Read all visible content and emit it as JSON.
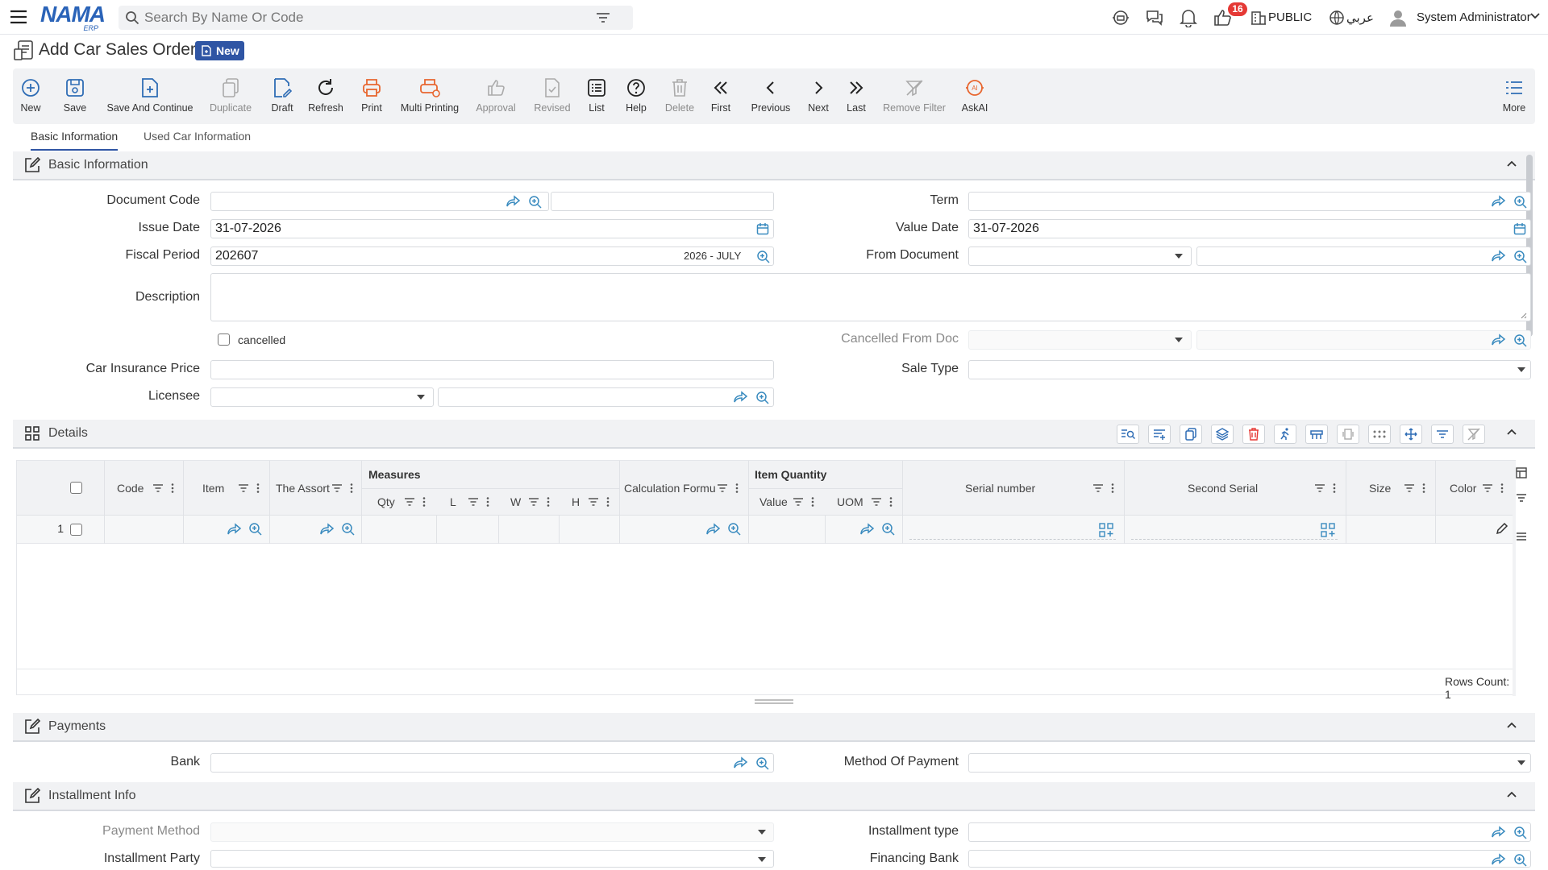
{
  "topbar": {
    "search_placeholder": "Search By Name Or Code",
    "notification_count": "16",
    "branch": "PUBLIC",
    "language": "عربي",
    "user": "System Administrator"
  },
  "page": {
    "title": "Add Car Sales Order",
    "status": "New"
  },
  "toolbar": {
    "new": "New",
    "save": "Save",
    "save_continue": "Save And Continue",
    "duplicate": "Duplicate",
    "draft": "Draft",
    "refresh": "Refresh",
    "print": "Print",
    "multi_printing": "Multi Printing",
    "approval": "Approval",
    "revised": "Revised",
    "list": "List",
    "help": "Help",
    "delete": "Delete",
    "first": "First",
    "previous": "Previous",
    "next": "Next",
    "last": "Last",
    "remove_filter": "Remove Filter",
    "askai": "AskAI",
    "more": "More"
  },
  "tabs": [
    "Basic Information",
    "Used Car Information"
  ],
  "basic": {
    "section": "Basic Information",
    "document_code": "Document Code",
    "term": "Term",
    "issue_date": "Issue Date",
    "issue_date_value": "31-07-2026",
    "value_date": "Value Date",
    "value_date_value": "31-07-2026",
    "fiscal_period": "Fiscal Period",
    "fiscal_period_value": "202607",
    "fiscal_period_name": "2026 - JULY",
    "from_document": "From Document",
    "description": "Description",
    "cancelled": "cancelled",
    "cancelled_from_doc": "Cancelled From Doc",
    "car_insurance_price": "Car Insurance Price",
    "sale_type": "Sale Type",
    "licensee": "Licensee"
  },
  "details": {
    "section": "Details",
    "group_measures": "Measures",
    "group_item_quantity": "Item Quantity",
    "columns": {
      "code": "Code",
      "item": "Item",
      "assort": "The Assort",
      "qty": "Qty",
      "l": "L",
      "w": "W",
      "h": "H",
      "calc": "Calculation Formu",
      "value": "Value",
      "uom": "UOM",
      "serial": "Serial number",
      "second_serial": "Second Serial",
      "size": "Size",
      "color": "Color"
    },
    "row_number": "1",
    "rows_count": "Rows Count: 1"
  },
  "payments": {
    "section": "Payments",
    "bank": "Bank",
    "method_of_payment": "Method Of Payment"
  },
  "installment": {
    "section": "Installment Info",
    "payment_method": "Payment Method",
    "installment_type": "Installment type",
    "installment_party": "Installment Party",
    "financing_bank": "Financing Bank"
  }
}
